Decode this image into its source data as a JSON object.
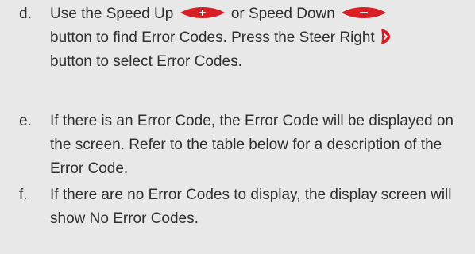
{
  "steps": [
    {
      "marker": "d.",
      "parts": {
        "p1": "Use the Speed Up",
        "p2": "or Speed Down",
        "p3": "button to find Error Codes. Press the Steer Right",
        "p4": "button to select Error Codes."
      },
      "icons": [
        "speed-up-button-icon",
        "speed-down-button-icon",
        "steer-right-button-icon"
      ]
    },
    {
      "marker": "e.",
      "text": "If there is an Error Code, the Error Code will be displayed on the screen. Refer to the table below for a description of the Error Code."
    },
    {
      "marker": "f.",
      "text": "If there are no Error Codes to display, the display screen will show No Error Codes."
    }
  ],
  "colors": {
    "background": "#e8e8e8",
    "text": "#2e2e2e",
    "button_red": "#d81f26"
  }
}
